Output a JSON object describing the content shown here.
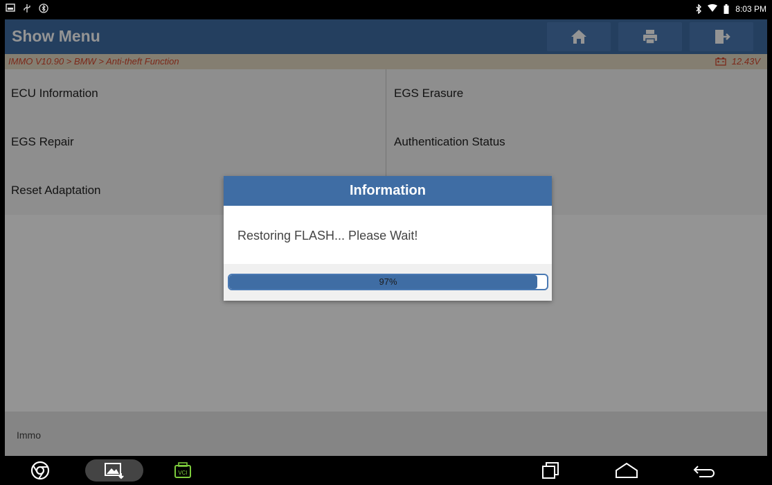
{
  "status_bar": {
    "left_icons": [
      "screenshot-icon",
      "usb-icon",
      "bluetooth-settings-icon"
    ],
    "right_icons": [
      "bluetooth-icon",
      "wifi-icon",
      "battery-icon"
    ],
    "time": "8:03 PM"
  },
  "header": {
    "title": "Show Menu",
    "buttons": [
      "home-icon",
      "print-icon",
      "exit-icon"
    ]
  },
  "breadcrumb": {
    "path": "IMMO V10.90 > BMW > Anti-theft Function",
    "voltage": "12.43V"
  },
  "menu": {
    "rows": [
      {
        "left": "ECU Information",
        "right": "EGS Erasure"
      },
      {
        "left": "EGS Repair",
        "right": "Authentication Status"
      },
      {
        "left": "Reset Adaptation",
        "right": ""
      }
    ]
  },
  "footer": {
    "label": "Immo"
  },
  "dialog": {
    "title": "Information",
    "message": "Restoring FLASH... Please Wait!",
    "progress_percent": 97,
    "progress_label": "97%"
  },
  "colors": {
    "brand": "#3f6da4",
    "breadcrumb_text": "#d4462b",
    "breadcrumb_bg": "#e4d9c3"
  },
  "nav": {
    "items": [
      "chrome-icon",
      "gallery-icon",
      "vci-icon",
      "recents-icon",
      "home-nav-icon",
      "back-icon"
    ],
    "vci_label": "VCI"
  }
}
